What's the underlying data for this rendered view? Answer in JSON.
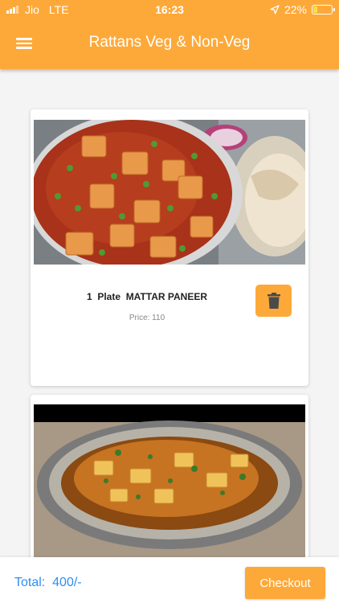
{
  "status_bar": {
    "carrier": "Jio",
    "network": "LTE",
    "time": "16:23",
    "battery": "22%",
    "battery_level": 0.22
  },
  "header": {
    "title": "Rattans Veg & Non-Veg",
    "menu_icon": "hamburger-menu-icon"
  },
  "cart_items": [
    {
      "quantity": "1",
      "unit": "Plate",
      "name": "MATTAR PANEER",
      "price_text": "Price: 110"
    },
    {
      "image": "paneer-curry-in-bowl"
    }
  ],
  "footer": {
    "total_label": "Total:",
    "total_value": "400/-",
    "checkout_label": "Checkout"
  },
  "colors": {
    "primary": "#fda93a",
    "total_text": "#2e8ef0",
    "background": "#f4f4f4"
  }
}
